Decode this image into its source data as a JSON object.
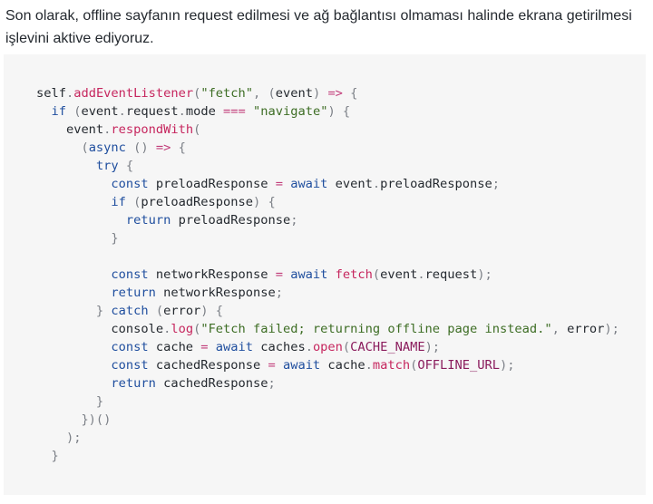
{
  "intro": {
    "text": "Son olarak, offline sayfanın request edilmesi ve ağ bağlantısı olmaması halinde ekrana getirilmesi işlevini aktive ediyoruz."
  },
  "code": {
    "language": "javascript",
    "colors": {
      "keyword": "#1f4e9e",
      "function": "#c6265e",
      "string": "#3d6d24",
      "operator": "#c23d7a",
      "constant": "#8a1b5c",
      "punctuation": "#7b7f86",
      "text": "#24292f",
      "background": "#f6f6f6"
    },
    "lines": [
      [
        [
          "p",
          "self"
        ],
        [
          "u",
          "."
        ],
        [
          "f",
          "addEventListener"
        ],
        [
          "u",
          "("
        ],
        [
          "s",
          "\"fetch\""
        ],
        [
          "u",
          ", ("
        ],
        [
          "p",
          "event"
        ],
        [
          "u",
          ") "
        ],
        [
          "o",
          "=>"
        ],
        [
          "u",
          " {"
        ]
      ],
      [
        [
          "p",
          "  "
        ],
        [
          "k",
          "if"
        ],
        [
          "u",
          " ("
        ],
        [
          "p",
          "event"
        ],
        [
          "u",
          "."
        ],
        [
          "p",
          "request"
        ],
        [
          "u",
          "."
        ],
        [
          "p",
          "mode "
        ],
        [
          "o",
          "==="
        ],
        [
          "p",
          " "
        ],
        [
          "s",
          "\"navigate\""
        ],
        [
          "u",
          ") {"
        ]
      ],
      [
        [
          "p",
          "    event"
        ],
        [
          "u",
          "."
        ],
        [
          "f",
          "respondWith"
        ],
        [
          "u",
          "("
        ]
      ],
      [
        [
          "u",
          "      ("
        ],
        [
          "k",
          "async"
        ],
        [
          "u",
          " () "
        ],
        [
          "o",
          "=>"
        ],
        [
          "u",
          " {"
        ]
      ],
      [
        [
          "p",
          "        "
        ],
        [
          "k",
          "try"
        ],
        [
          "u",
          " {"
        ]
      ],
      [
        [
          "p",
          "          "
        ],
        [
          "k",
          "const"
        ],
        [
          "p",
          " preloadResponse "
        ],
        [
          "o",
          "="
        ],
        [
          "p",
          " "
        ],
        [
          "k",
          "await"
        ],
        [
          "p",
          " event"
        ],
        [
          "u",
          "."
        ],
        [
          "p",
          "preloadResponse"
        ],
        [
          "u",
          ";"
        ]
      ],
      [
        [
          "p",
          "          "
        ],
        [
          "k",
          "if"
        ],
        [
          "u",
          " ("
        ],
        [
          "p",
          "preloadResponse"
        ],
        [
          "u",
          ") {"
        ]
      ],
      [
        [
          "p",
          "            "
        ],
        [
          "k",
          "return"
        ],
        [
          "p",
          " preloadResponse"
        ],
        [
          "u",
          ";"
        ]
      ],
      [
        [
          "u",
          "          }"
        ]
      ],
      [
        [
          "p",
          ""
        ]
      ],
      [
        [
          "p",
          "          "
        ],
        [
          "k",
          "const"
        ],
        [
          "p",
          " networkResponse "
        ],
        [
          "o",
          "="
        ],
        [
          "p",
          " "
        ],
        [
          "k",
          "await"
        ],
        [
          "p",
          " "
        ],
        [
          "f",
          "fetch"
        ],
        [
          "u",
          "("
        ],
        [
          "p",
          "event"
        ],
        [
          "u",
          "."
        ],
        [
          "p",
          "request"
        ],
        [
          "u",
          ");"
        ]
      ],
      [
        [
          "p",
          "          "
        ],
        [
          "k",
          "return"
        ],
        [
          "p",
          " networkResponse"
        ],
        [
          "u",
          ";"
        ]
      ],
      [
        [
          "u",
          "        } "
        ],
        [
          "k",
          "catch"
        ],
        [
          "u",
          " ("
        ],
        [
          "p",
          "error"
        ],
        [
          "u",
          ") {"
        ]
      ],
      [
        [
          "p",
          "          console"
        ],
        [
          "u",
          "."
        ],
        [
          "f",
          "log"
        ],
        [
          "u",
          "("
        ],
        [
          "s",
          "\"Fetch failed; returning offline page instead.\""
        ],
        [
          "u",
          ", "
        ],
        [
          "p",
          "error"
        ],
        [
          "u",
          ");"
        ]
      ],
      [
        [
          "p",
          "          "
        ],
        [
          "k",
          "const"
        ],
        [
          "p",
          " cache "
        ],
        [
          "o",
          "="
        ],
        [
          "p",
          " "
        ],
        [
          "k",
          "await"
        ],
        [
          "p",
          " caches"
        ],
        [
          "u",
          "."
        ],
        [
          "f",
          "open"
        ],
        [
          "u",
          "("
        ],
        [
          "c",
          "CACHE_NAME"
        ],
        [
          "u",
          ");"
        ]
      ],
      [
        [
          "p",
          "          "
        ],
        [
          "k",
          "const"
        ],
        [
          "p",
          " cachedResponse "
        ],
        [
          "o",
          "="
        ],
        [
          "p",
          " "
        ],
        [
          "k",
          "await"
        ],
        [
          "p",
          " cache"
        ],
        [
          "u",
          "."
        ],
        [
          "f",
          "match"
        ],
        [
          "u",
          "("
        ],
        [
          "c",
          "OFFLINE_URL"
        ],
        [
          "u",
          ");"
        ]
      ],
      [
        [
          "p",
          "          "
        ],
        [
          "k",
          "return"
        ],
        [
          "p",
          " cachedResponse"
        ],
        [
          "u",
          ";"
        ]
      ],
      [
        [
          "u",
          "        }"
        ]
      ],
      [
        [
          "u",
          "      })()"
        ]
      ],
      [
        [
          "u",
          "    );"
        ]
      ],
      [
        [
          "u",
          "  }"
        ]
      ]
    ]
  }
}
